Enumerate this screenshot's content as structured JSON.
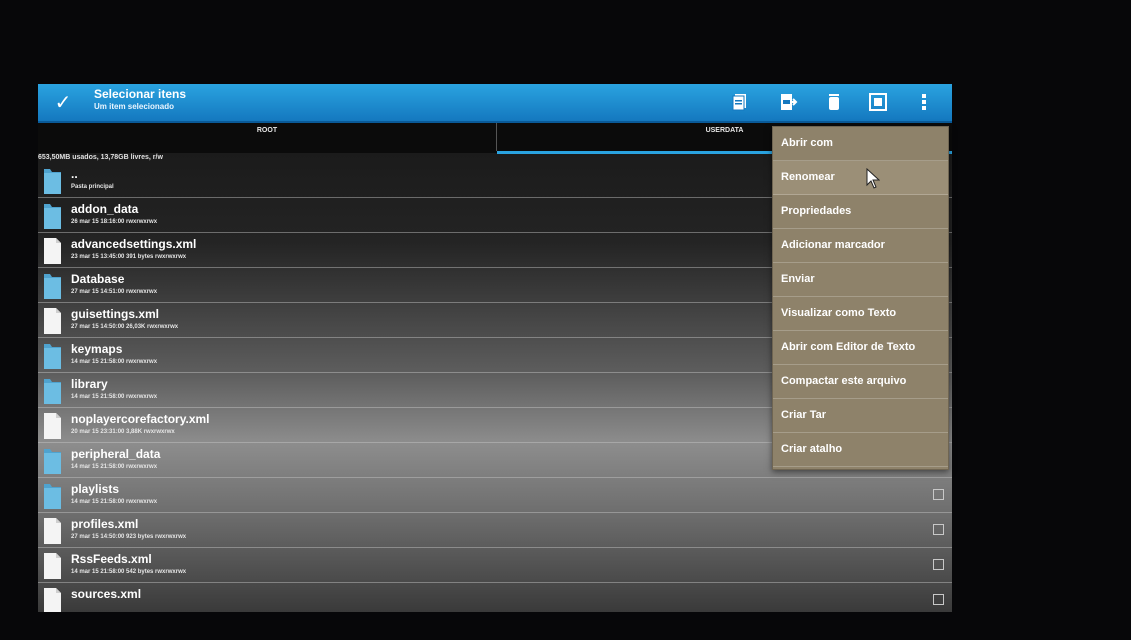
{
  "actionbar": {
    "title": "Selecionar itens",
    "subtitle": "Um item selecionado",
    "icons": [
      "check-icon",
      "copy-icon",
      "cut-icon",
      "delete-icon",
      "select-all-icon",
      "overflow-menu-icon"
    ]
  },
  "tabs": {
    "root": "ROOT",
    "userdata": "USERDATA"
  },
  "storage_info": "653,50MB usados, 13,78GB livres, r/w",
  "files": [
    {
      "name": "..",
      "meta": "Pasta principal",
      "type": "folder"
    },
    {
      "name": "addon_data",
      "meta": "26 mar 15 18:16:00  rwxrwxrwx",
      "type": "folder"
    },
    {
      "name": "advancedsettings.xml",
      "meta": "23 mar 15 13:45:00  391 bytes  rwxrwxrwx",
      "type": "file"
    },
    {
      "name": "Database",
      "meta": "27 mar 15 14:51:00  rwxrwxrwx",
      "type": "folder"
    },
    {
      "name": "guisettings.xml",
      "meta": "27 mar 15 14:50:00  26,03K  rwxrwxrwx",
      "type": "file"
    },
    {
      "name": "keymaps",
      "meta": "14 mar 15 21:58:00  rwxrwxrwx",
      "type": "folder"
    },
    {
      "name": "library",
      "meta": "14 mar 15 21:58:00  rwxrwxrwx",
      "type": "folder"
    },
    {
      "name": "noplayercorefactory.xml",
      "meta": "20 mar 15 23:31:00  3,88K  rwxrwxrwx",
      "type": "file"
    },
    {
      "name": "peripheral_data",
      "meta": "14 mar 15 21:58:00  rwxrwxrwx",
      "type": "folder"
    },
    {
      "name": "playlists",
      "meta": "14 mar 15 21:58:00  rwxrwxrwx",
      "type": "folder"
    },
    {
      "name": "profiles.xml",
      "meta": "27 mar 15 14:50:00  923 bytes  rwxrwxrwx",
      "type": "file"
    },
    {
      "name": "RssFeeds.xml",
      "meta": "14 mar 15 21:58:00  542 bytes  rwxrwxrwx",
      "type": "file"
    },
    {
      "name": "sources.xml",
      "meta": "",
      "type": "file"
    }
  ],
  "context_menu": [
    "Abrir com",
    "Renomear",
    "Propriedades",
    "Adicionar marcador",
    "Enviar",
    "Visualizar como Texto",
    "Abrir com Editor de Texto",
    "Compactar este arquivo",
    "Criar Tar",
    "Criar atalho"
  ],
  "colors": {
    "actionbar": "#1f8fd4",
    "tab_indicator": "#2aa3e0",
    "menu_bg": "#8e826a",
    "folder": "#4fa3cf"
  }
}
